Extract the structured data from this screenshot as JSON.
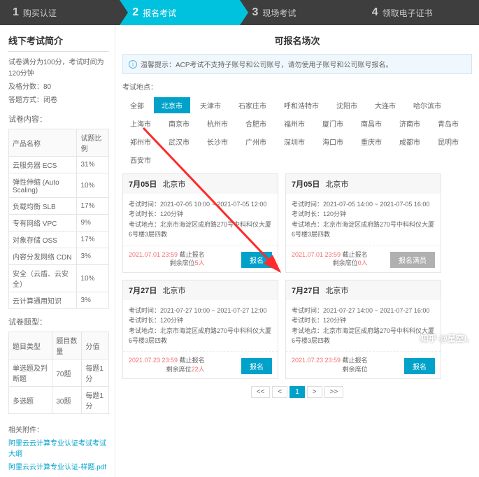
{
  "steps": [
    {
      "num": "1",
      "label": "购买认证"
    },
    {
      "num": "2",
      "label": "报名考试"
    },
    {
      "num": "3",
      "label": "现场考试"
    },
    {
      "num": "4",
      "label": "领取电子证书"
    }
  ],
  "sidebar": {
    "title": "线下考试简介",
    "line1": "试卷满分为100分，考试时间为120分钟",
    "line2": "及格分数：80",
    "line3": "答题方式：闭卷",
    "contentLabel": "试卷内容：",
    "tbl1": {
      "h1": "产品名称",
      "h2": "试题比例",
      "rows": [
        [
          "云服务器 ECS",
          "31%"
        ],
        [
          "弹性伸缩 (Auto Scaling)",
          "10%"
        ],
        [
          "负载均衡 SLB",
          "17%"
        ],
        [
          "专有网络 VPC",
          "9%"
        ],
        [
          "对象存储 OSS",
          "17%"
        ],
        [
          "内容分发网络 CDN",
          "3%"
        ],
        [
          "安全（云盾、云安全）",
          "10%"
        ],
        [
          "云计算通用知识",
          "3%"
        ]
      ]
    },
    "typeLabel": "试卷题型：",
    "tbl2": {
      "h1": "题目类型",
      "h2": "题目数量",
      "h3": "分值",
      "rows": [
        [
          "单选题及判断题",
          "70题",
          "每题1分"
        ],
        [
          "多选题",
          "30题",
          "每题1分"
        ]
      ]
    },
    "attachLabel": "相关附件：",
    "attach1": "阿里云云计算专业认证考试考试大纲",
    "attach2": "阿里云云计算专业认证-样题.pdf"
  },
  "content": {
    "title": "可报名场次",
    "alert": "温馨提示：ACP考试不支持子账号和公司账号，请勿使用子账号和公司账号报名。",
    "locLabel": "考试地点：",
    "cities": [
      "全部",
      "北京市",
      "天津市",
      "石家庄市",
      "呼和浩特市",
      "沈阳市",
      "大连市",
      "哈尔滨市",
      "上海市",
      "南京市",
      "杭州市",
      "合肥市",
      "福州市",
      "厦门市",
      "南昌市",
      "济南市",
      "青岛市",
      "郑州市",
      "武汉市",
      "长沙市",
      "广州市",
      "深圳市",
      "海口市",
      "重庆市",
      "成都市",
      "昆明市",
      "西安市"
    ],
    "activeCity": "北京市",
    "lblTime": "考试时间：",
    "lblDur": "考试时长：",
    "lblAddr": "考试地点：",
    "dur": "120分钟",
    "addr": "北京市海淀区成府路270号中科科仪大厦6号楼3层四教",
    "deadlineSuffix": "截止报名",
    "seatPrefix": "剩余席位",
    "btnEnroll": "报名",
    "btnFull": "报名满员",
    "sessions": [
      {
        "date": "7月05日",
        "city": "北京市",
        "time": "2021-07-05 10:00 ~ 2021-07-05 12:00",
        "deadline": "2021.07.01 23:59",
        "seats": "5人",
        "full": false
      },
      {
        "date": "7月05日",
        "city": "北京市",
        "time": "2021-07-05 14:00 ~ 2021-07-05 16:00",
        "deadline": "2021.07.01 23:59",
        "seats": "0人",
        "full": true
      },
      {
        "date": "7月27日",
        "city": "北京市",
        "time": "2021-07-27 10:00 ~ 2021-07-27 12:00",
        "deadline": "2021.07.23 23:59",
        "seats": "22人",
        "full": false
      },
      {
        "date": "7月27日",
        "city": "北京市",
        "time": "2021-07-27 14:00 ~ 2021-07-27 16:00",
        "deadline": "2021.07.23 23:59",
        "seats": "",
        "full": false
      }
    ],
    "pager": [
      "<<",
      "<",
      "1",
      ">",
      ">>"
    ]
  },
  "watermark": "知乎 @星空L"
}
